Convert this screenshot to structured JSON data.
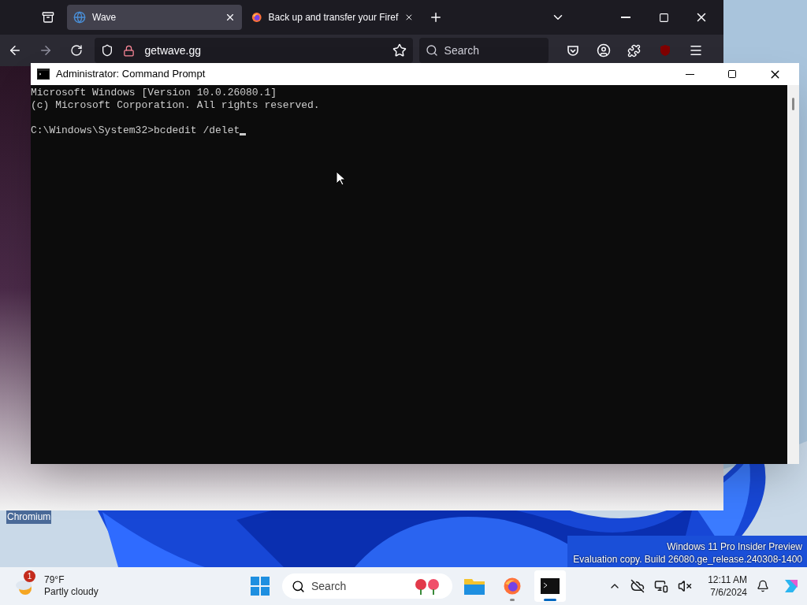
{
  "browser": {
    "tabs": [
      {
        "title": "Wave",
        "selected": true,
        "kind": "globe"
      },
      {
        "title": "Back up and transfer your Firef",
        "selected": false,
        "kind": "firefox"
      }
    ],
    "address": "getwave.gg",
    "search": {
      "placeholder": "Search"
    }
  },
  "terminal": {
    "title": "Administrator: Command Prompt",
    "banner": [
      "Microsoft Windows [Version 10.0.26080.1]",
      "(c) Microsoft Corporation. All rights reserved."
    ],
    "prompt": "C:\\Windows\\System32>bcdedit /delet",
    "cursor": true
  },
  "desktop_icons": [
    {
      "label": "Chromium"
    }
  ],
  "watermark": [
    "Windows 11 Pro Insider Preview",
    "Evaluation copy. Build 26080.ge_release.240308-1400"
  ],
  "taskbar": {
    "weather": {
      "badge": "1",
      "temperature": "79°F",
      "condition": "Partly cloudy"
    },
    "search": {
      "placeholder": "Search"
    },
    "apps": [
      {
        "kind": "files",
        "running": false,
        "active": false
      },
      {
        "kind": "firefox",
        "running": true,
        "active": false
      },
      {
        "kind": "terminal",
        "running": true,
        "active": true
      }
    ],
    "clock": {
      "time": "12:11 AM",
      "date": "7/6/2024"
    }
  }
}
